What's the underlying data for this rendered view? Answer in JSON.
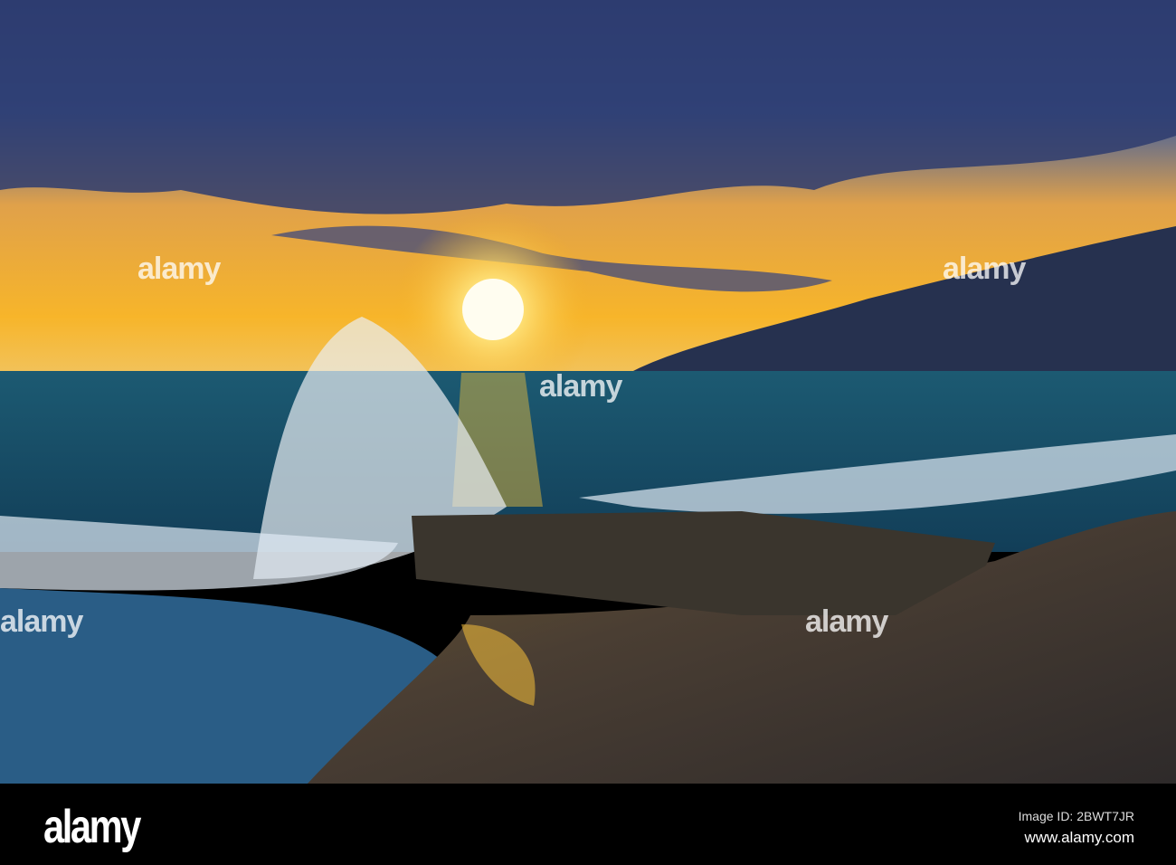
{
  "watermark": {
    "text": "alamy"
  },
  "footer": {
    "logo": "alamy",
    "image_id": "Image ID: 2BWT7JR",
    "website": "www.alamy.com"
  },
  "colors": {
    "sky_top": "#2b3f7a",
    "sun": "#fff6c8",
    "horizon": "#f5b021",
    "sea": "#1f5f7a",
    "sand": "#4a3e33"
  }
}
